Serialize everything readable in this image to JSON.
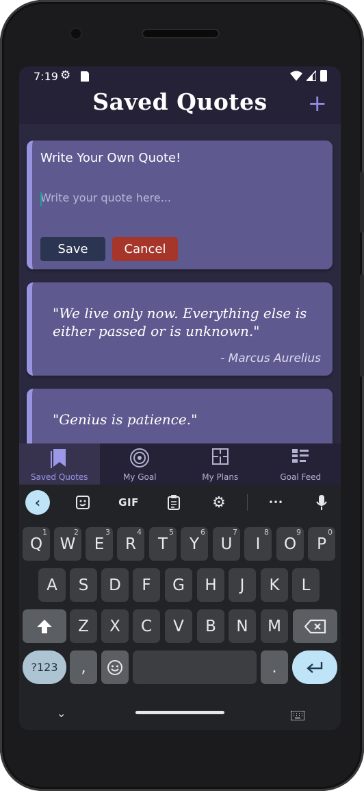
{
  "status_bar": {
    "time": "7:19"
  },
  "app_bar": {
    "title": "Saved Quotes",
    "add_label": "+"
  },
  "write_card": {
    "title": "Write Your Own Quote!",
    "placeholder": "Write your quote here...",
    "save_label": "Save",
    "cancel_label": "Cancel"
  },
  "quotes": [
    {
      "text": "\"We live only now. Everything else is either passed or is unknown.\"",
      "author": "- Marcus Aurelius"
    },
    {
      "text": "\"Genius is patience.\"",
      "author": ""
    }
  ],
  "bottom_nav": {
    "items": [
      {
        "label": "Saved Quotes",
        "icon": "bookmark-icon",
        "active": true
      },
      {
        "label": "My Goal",
        "icon": "target-icon",
        "active": false
      },
      {
        "label": "My Plans",
        "icon": "floorplan-icon",
        "active": false
      },
      {
        "label": "Goal Feed",
        "icon": "feed-icon",
        "active": false
      }
    ]
  },
  "keyboard": {
    "toolbar": {
      "gif_label": "GIF",
      "more_label": "•••"
    },
    "row1": [
      {
        "key": "Q",
        "num": "1"
      },
      {
        "key": "W",
        "num": "2"
      },
      {
        "key": "E",
        "num": "3"
      },
      {
        "key": "R",
        "num": "4"
      },
      {
        "key": "T",
        "num": "5"
      },
      {
        "key": "Y",
        "num": "6"
      },
      {
        "key": "U",
        "num": "7"
      },
      {
        "key": "I",
        "num": "8"
      },
      {
        "key": "O",
        "num": "9"
      },
      {
        "key": "P",
        "num": "0"
      }
    ],
    "row2": [
      "A",
      "S",
      "D",
      "F",
      "G",
      "H",
      "J",
      "K",
      "L"
    ],
    "row3": [
      "Z",
      "X",
      "C",
      "V",
      "B",
      "N",
      "M"
    ],
    "symbols_label": "?123",
    "comma_label": ",",
    "period_label": ".",
    "colors": {
      "accent": "#bfe3f7",
      "key": "#3c3e42",
      "func_key": "#5b5e63"
    }
  },
  "colors": {
    "background": "#2b2940",
    "bar": "#252238",
    "card": "#5e5a8f",
    "card_accent": "#9894e0",
    "save": "#2b3450",
    "cancel": "#a6352a",
    "add_icon": "#8f8ae2"
  }
}
